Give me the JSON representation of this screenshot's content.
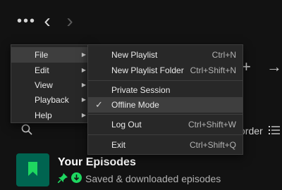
{
  "topbar": {
    "more_icon": "more-horizontal-icon",
    "more_glyph": "•••",
    "back_icon": "chevron-left-icon",
    "back_glyph": "‹",
    "forward_icon": "chevron-right-icon",
    "forward_glyph": "›"
  },
  "library": {
    "add_glyph": "+",
    "expand_glyph": "→",
    "sort_label": "order",
    "episodes": {
      "title": "Your Episodes",
      "subtitle": "Saved & downloaded episodes",
      "thumb_color": "#006450"
    }
  },
  "menu": {
    "items": [
      {
        "label": "File",
        "active": true
      },
      {
        "label": "Edit"
      },
      {
        "label": "View"
      },
      {
        "label": "Playback"
      },
      {
        "label": "Help"
      }
    ],
    "chevron_glyph": "▶"
  },
  "file_submenu": {
    "new_playlist": {
      "label": "New Playlist",
      "shortcut": "Ctrl+N"
    },
    "new_playlist_folder": {
      "label": "New Playlist Folder",
      "shortcut": "Ctrl+Shift+N"
    },
    "private_session": {
      "label": "Private Session"
    },
    "offline_mode": {
      "label": "Offline Mode",
      "checked": true,
      "check_glyph": "✓"
    },
    "log_out": {
      "label": "Log Out",
      "shortcut": "Ctrl+Shift+W"
    },
    "exit": {
      "label": "Exit",
      "shortcut": "Ctrl+Shift+Q"
    }
  },
  "colors": {
    "background": "#121212",
    "menu_bg": "#282828",
    "hover": "#3e3e3e",
    "accent_green": "#1ed760"
  }
}
